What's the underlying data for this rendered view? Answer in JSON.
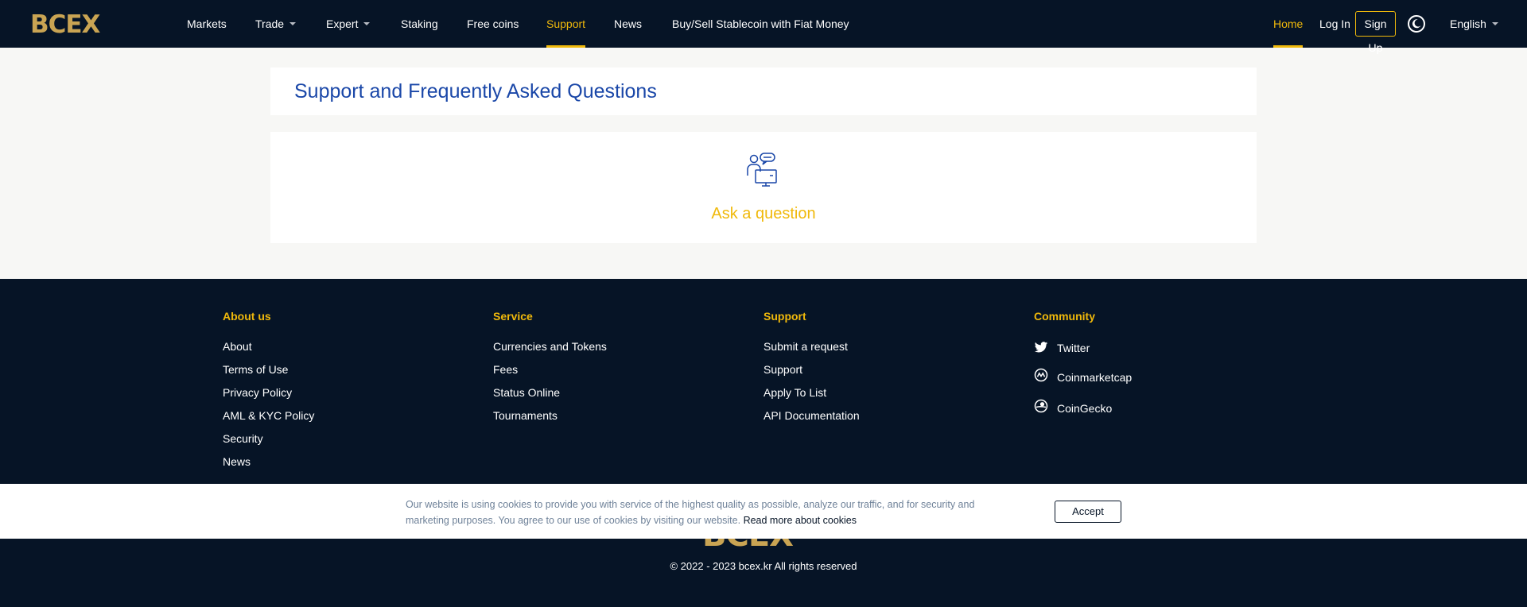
{
  "header": {
    "logo": "BCEX",
    "nav": [
      {
        "label": "Markets"
      },
      {
        "label": "Trade"
      },
      {
        "label": "Expert"
      },
      {
        "label": "Staking"
      },
      {
        "label": "Free coins"
      },
      {
        "label": "Support"
      },
      {
        "label": "News"
      },
      {
        "label": "Buy/Sell Stablecoin with Fiat Money"
      }
    ],
    "right": {
      "home": "Home",
      "login": "Log In",
      "signup": "Sign Up",
      "theme_icon": "moon-icon",
      "language": "English"
    }
  },
  "main": {
    "title": "Support and Frequently Asked Questions",
    "ask_label": "Ask a question",
    "ask_icon": "support-agent-icon"
  },
  "footer": {
    "about": {
      "title": "About us",
      "links": [
        "About",
        "Terms of Use",
        "Privacy Policy",
        "AML & KYC Policy",
        "Security",
        "News"
      ]
    },
    "service": {
      "title": "Service",
      "links": [
        "Currencies and Tokens",
        "Fees",
        "Status Online",
        "Tournaments"
      ]
    },
    "support": {
      "title": "Support",
      "links": [
        "Submit a request",
        "Support",
        "Apply To List",
        "API Documentation"
      ]
    },
    "community": {
      "title": "Community",
      "links": [
        {
          "label": "Twitter",
          "icon": "twitter-icon"
        },
        {
          "label": "Coinmarketcap",
          "icon": "coinmarketcap-icon"
        },
        {
          "label": "CoinGecko",
          "icon": "coingecko-icon"
        }
      ]
    },
    "logo": "BCEX",
    "copyright": "© 2022 - 2023 bcex.kr All rights reserved"
  },
  "cookie": {
    "text": "Our website is using cookies to provide you with service of the highest quality as possible, analyze our traffic, and for security and marketing purposes. You agree to our use of cookies by visiting our website.",
    "link": "Read more about cookies",
    "accept": "Accept"
  },
  "colors": {
    "header_bg": "#061426",
    "accent": "#f0b90b",
    "title_blue": "#1a47a8",
    "logo_gold": "#c9a453"
  }
}
